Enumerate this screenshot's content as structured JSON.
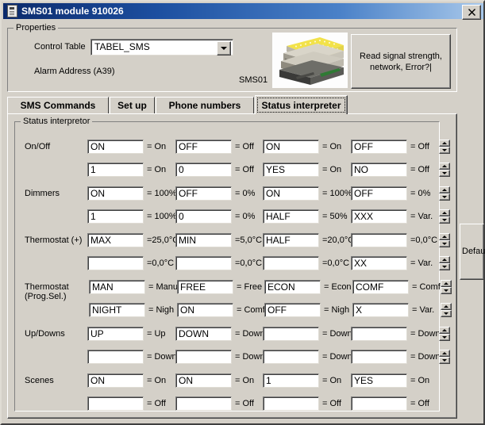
{
  "window": {
    "title": "SMS01 module 910026",
    "icon": "module-icon",
    "close_label": "✕"
  },
  "properties": {
    "group_label": "Properties",
    "control_table_label": "Control Table",
    "control_table_value": "TABEL_SMS",
    "alarm_address_label": "Alarm Address (A39)",
    "photo_caption": "SMS01",
    "read_button": "Read signal strength, network, Error?|"
  },
  "tabs": [
    {
      "label": "SMS Commands",
      "active": false
    },
    {
      "label": "Set up",
      "active": false
    },
    {
      "label": "Phone numbers",
      "active": false
    },
    {
      "label": "Status interpreter",
      "active": true
    }
  ],
  "status_interpreter": {
    "group_label": "Status interpretor",
    "default_button": "Default",
    "rows": [
      {
        "name": "On/Off",
        "label": "On/Off",
        "has_spinners": true,
        "lines": [
          [
            {
              "value": "ON",
              "unit": "= On"
            },
            {
              "value": "OFF",
              "unit": "= Off"
            },
            {
              "value": "ON",
              "unit": "= On"
            },
            {
              "value": "OFF",
              "unit": "= Off"
            }
          ],
          [
            {
              "value": "1",
              "unit": "= On"
            },
            {
              "value": "0",
              "unit": "= Off"
            },
            {
              "value": "YES",
              "unit": "= On"
            },
            {
              "value": "NO",
              "unit": "= Off"
            }
          ]
        ]
      },
      {
        "name": "Dimmers",
        "label": "Dimmers",
        "has_spinners": true,
        "lines": [
          [
            {
              "value": "ON",
              "unit": "= 100%"
            },
            {
              "value": "OFF",
              "unit": "= 0%"
            },
            {
              "value": "ON",
              "unit": "= 100%"
            },
            {
              "value": "OFF",
              "unit": "= 0%"
            }
          ],
          [
            {
              "value": "1",
              "unit": "= 100%"
            },
            {
              "value": "0",
              "unit": "= 0%"
            },
            {
              "value": "HALF",
              "unit": "= 50%"
            },
            {
              "value": "XXX",
              "unit": "= Var."
            }
          ]
        ]
      },
      {
        "name": "Thermostat (+)",
        "label": "Thermostat (+)",
        "has_spinners": true,
        "lines": [
          [
            {
              "value": "MAX",
              "unit": "=25,0°C"
            },
            {
              "value": "MIN",
              "unit": "=5,0°C"
            },
            {
              "value": "HALF",
              "unit": "=20,0°C"
            },
            {
              "value": "",
              "unit": "=0,0°C"
            }
          ],
          [
            {
              "value": "",
              "unit": "=0,0°C"
            },
            {
              "value": "",
              "unit": "=0,0°C"
            },
            {
              "value": "",
              "unit": "=0,0°C"
            },
            {
              "value": "XX",
              "unit": "= Var."
            }
          ]
        ]
      },
      {
        "name": "Thermostat (Prog.Sel.)",
        "label": "Thermostat\n(Prog.Sel.)",
        "has_spinners": true,
        "lines": [
          [
            {
              "value": "MAN",
              "unit": "= Manu"
            },
            {
              "value": "FREE",
              "unit": "= Free"
            },
            {
              "value": "ECON",
              "unit": "= Econ"
            },
            {
              "value": "COMF",
              "unit": "= Comf"
            }
          ],
          [
            {
              "value": "NIGHT",
              "unit": "= Nigh"
            },
            {
              "value": "ON",
              "unit": "= Comf"
            },
            {
              "value": "OFF",
              "unit": "= Nigh"
            },
            {
              "value": "X",
              "unit": "= Var."
            }
          ]
        ]
      },
      {
        "name": "Up/Downs",
        "label": "Up/Downs",
        "has_spinners": true,
        "lines": [
          [
            {
              "value": "UP",
              "unit": "= Up"
            },
            {
              "value": "DOWN",
              "unit": "= Down"
            },
            {
              "value": "",
              "unit": "= Down"
            },
            {
              "value": "",
              "unit": "= Down"
            }
          ],
          [
            {
              "value": "",
              "unit": "= Down"
            },
            {
              "value": "",
              "unit": "= Down"
            },
            {
              "value": "",
              "unit": "= Down"
            },
            {
              "value": "",
              "unit": "= Down"
            }
          ]
        ]
      },
      {
        "name": "Scenes",
        "label": "Scenes",
        "has_spinners": false,
        "lines": [
          [
            {
              "value": "ON",
              "unit": "= On"
            },
            {
              "value": "ON",
              "unit": "= On"
            },
            {
              "value": "1",
              "unit": "= On"
            },
            {
              "value": "YES",
              "unit": "= On"
            }
          ],
          [
            {
              "value": "",
              "unit": "= Off"
            },
            {
              "value": "",
              "unit": "= Off"
            },
            {
              "value": "",
              "unit": "= Off"
            },
            {
              "value": "",
              "unit": "= Off"
            }
          ]
        ]
      }
    ]
  },
  "colors": {
    "face": "#d4d0c8",
    "title_dark": "#0b2a6b",
    "title_light": "#a8c8ea",
    "field_bg": "#ffffff"
  }
}
